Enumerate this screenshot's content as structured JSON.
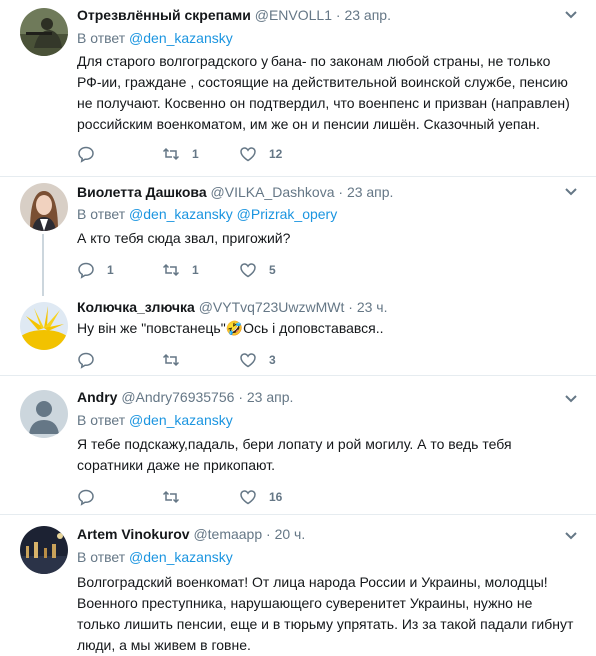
{
  "tweets": [
    {
      "name": "Отрезвлённый скрепами",
      "handle": "@ENVOLL1",
      "time": "23 апр.",
      "reply_prefix": "В ответ",
      "reply_to": "@den_kazansky",
      "reply_to_2": "",
      "text": "Для старого волгоградского у бана- по законам любой страны, не только РФ-ии, граждане , состоящие на действительной воинской службе, пенсию не получают. Косвенно он подтвердил, что военпенс и призван (направлен) российским военкоматом, им же он и пенсии лишён. Сказочный уепан.",
      "replies": "",
      "retweets": "1",
      "likes": "12"
    },
    {
      "name": "Виолетта Дашкова",
      "handle": "@VILKA_Dashkova",
      "time": "23 апр.",
      "reply_prefix": "В ответ",
      "reply_to": "@den_kazansky",
      "reply_to_2": "@Prizrak_opery",
      "text": "А кто тебя сюда звал, пригожий?",
      "replies": "1",
      "retweets": "1",
      "likes": "5"
    },
    {
      "name": "Колючка_злючка",
      "handle": "@VYTvq723UwzwMWt",
      "time": "23 ч.",
      "reply_prefix": "",
      "reply_to": "",
      "reply_to_2": "",
      "text": "Ну він же \"повстанець\"🤣Ось і доповставався..",
      "replies": "",
      "retweets": "",
      "likes": "3"
    },
    {
      "name": "Andry",
      "handle": "@Andry76935756",
      "time": "23 апр.",
      "reply_prefix": "В ответ",
      "reply_to": "@den_kazansky",
      "reply_to_2": "",
      "text": "Я тебе подскажу,падаль, бери лопату и рой могилу. А то ведь тебя соратники даже не прикопают.",
      "replies": "",
      "retweets": "",
      "likes": "16"
    },
    {
      "name": "Artem Vinokurov",
      "handle": "@temaapp",
      "time": "20 ч.",
      "reply_prefix": "В ответ",
      "reply_to": "@den_kazansky",
      "reply_to_2": "",
      "text": "Волгоградский военкомат! От лица народа России и Украины, молодцы! Военного преступника, нарушающего суверенитет Украины, нужно не только лишить пенсии, еще и в тюрьму упрятать. Из за такой падали гибнут люди, а мы живем в говне.",
      "replies": "",
      "retweets": "",
      "likes": ""
    }
  ],
  "dot": "·",
  "colors": {
    "accent": "#1b95e0",
    "muted": "#657786",
    "text": "#14171a",
    "divider": "#e6ecf0"
  },
  "icons": [
    "reply-icon",
    "retweet-icon",
    "like-icon",
    "chevron-down-icon"
  ]
}
